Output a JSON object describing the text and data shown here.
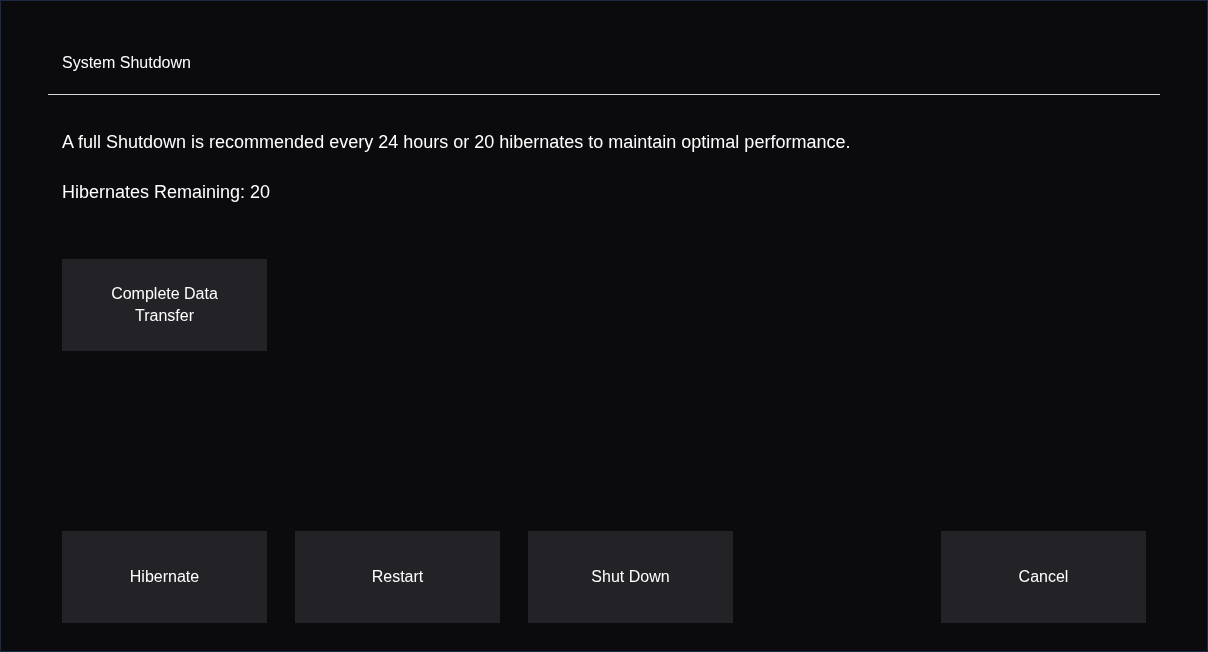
{
  "dialog": {
    "title": "System Shutdown",
    "message": "A full Shutdown is recommended every 24 hours or 20 hibernates to maintain optimal performance.",
    "status": "Hibernates Remaining: 20"
  },
  "action_buttons": [
    "Complete Data Transfer"
  ],
  "footer": {
    "left_buttons": [
      "Hibernate",
      "Restart",
      "Shut Down"
    ],
    "right_buttons": [
      "Cancel"
    ]
  }
}
